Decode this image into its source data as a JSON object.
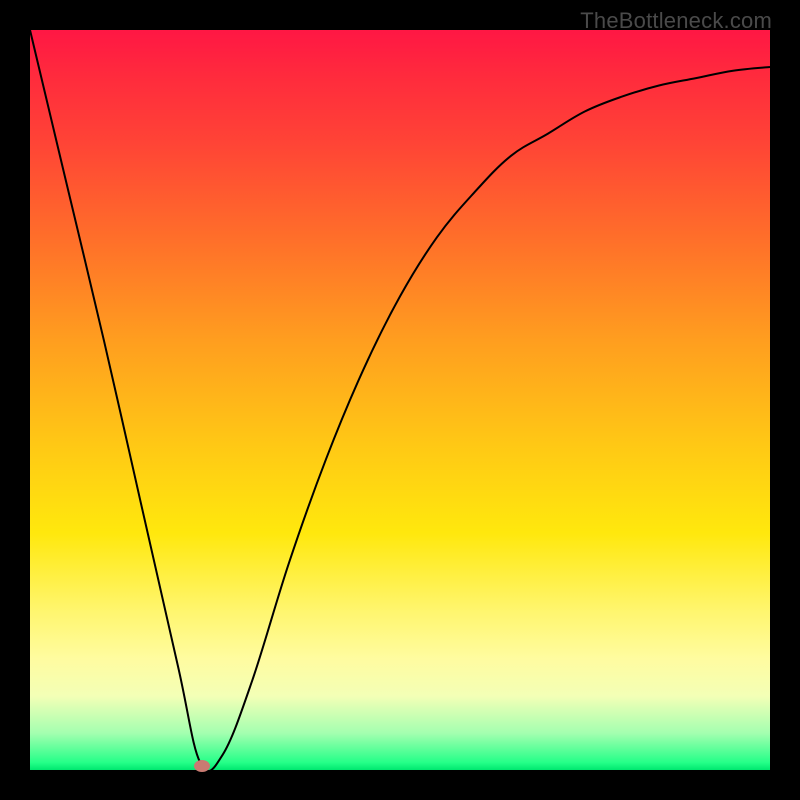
{
  "watermark": "TheBottleneck.com",
  "chart_data": {
    "type": "line",
    "title": "",
    "xlabel": "",
    "ylabel": "",
    "xlim": [
      0,
      1
    ],
    "ylim": [
      0,
      1
    ],
    "series": [
      {
        "name": "curve",
        "x": [
          0.0,
          0.05,
          0.1,
          0.15,
          0.2,
          0.23,
          0.26,
          0.3,
          0.35,
          0.4,
          0.45,
          0.5,
          0.55,
          0.6,
          0.65,
          0.7,
          0.75,
          0.8,
          0.85,
          0.9,
          0.95,
          1.0
        ],
        "values": [
          1.0,
          0.79,
          0.58,
          0.36,
          0.14,
          0.01,
          0.02,
          0.12,
          0.28,
          0.42,
          0.54,
          0.64,
          0.72,
          0.78,
          0.83,
          0.86,
          0.89,
          0.91,
          0.925,
          0.935,
          0.945,
          0.95
        ]
      }
    ],
    "marker": {
      "x": 0.232,
      "y": 0.005,
      "color": "#c97b72"
    },
    "gradient_stops": [
      {
        "pos": 0.0,
        "color": "#ff1744"
      },
      {
        "pos": 0.15,
        "color": "#ff4336"
      },
      {
        "pos": 0.42,
        "color": "#ff9e1f"
      },
      {
        "pos": 0.68,
        "color": "#ffe80d"
      },
      {
        "pos": 0.9,
        "color": "#f3ffb6"
      },
      {
        "pos": 1.0,
        "color": "#00e76f"
      }
    ]
  }
}
